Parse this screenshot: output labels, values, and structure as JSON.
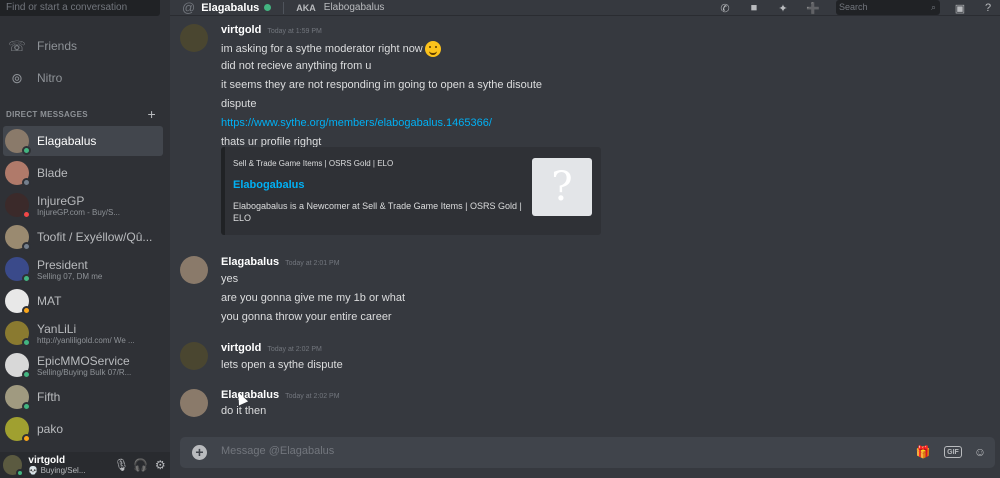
{
  "sidebar": {
    "search_placeholder": "Find or start a conversation",
    "nav": [
      {
        "label": "Friends",
        "icon": "friends-icon"
      },
      {
        "label": "Nitro",
        "icon": "nitro-icon"
      }
    ],
    "dm_header": "DIRECT MESSAGES",
    "dm_add": "+",
    "dms": [
      {
        "name": "Elagabalus",
        "sub": "",
        "status": "online",
        "avatar_color": "#8a7a6a",
        "active": true
      },
      {
        "name": "Blade",
        "sub": "",
        "status": "offline",
        "avatar_color": "#b07a6a",
        "active": false
      },
      {
        "name": "InjureGP",
        "sub": "InjureGP.com - Buy/S...",
        "status": "dnd",
        "avatar_color": "#3b2a2a",
        "active": false
      },
      {
        "name": "Toofit / Exyéllow/Qû...",
        "sub": "",
        "status": "offline",
        "avatar_color": "#9a8a70",
        "active": false
      },
      {
        "name": "President",
        "sub": "Selling 07, DM me",
        "status": "online",
        "avatar_color": "#3a4a8a",
        "active": false
      },
      {
        "name": "MAT",
        "sub": "",
        "status": "idle",
        "avatar_color": "#e8e8e8",
        "active": false
      },
      {
        "name": "YanLiLi",
        "sub": "http://yanliligold.com/ We ...",
        "status": "online",
        "avatar_color": "#8a7a30",
        "active": false
      },
      {
        "name": "EpicMMOService",
        "sub": "Selling/Buying Bulk 07/R...",
        "status": "online",
        "avatar_color": "#d8d8d8",
        "active": false
      },
      {
        "name": "Fifth",
        "sub": "",
        "status": "online",
        "avatar_color": "#a09a80",
        "active": false
      },
      {
        "name": "pako",
        "sub": "",
        "status": "idle",
        "avatar_color": "#a0a030",
        "active": false
      }
    ],
    "user": {
      "name": "virtgold",
      "status": "Buying/Sel..."
    }
  },
  "header": {
    "title": "Elagabalus",
    "aka_label": "AKA",
    "nickname": "Elabogabalus",
    "search_placeholder": "Search"
  },
  "messages": [
    {
      "author": "virtgold",
      "time": "Today at 1:59 PM",
      "avatar_color": "#4a4630",
      "lines": [
        "im asking for a sythe moderator right now",
        "did not recieve anything from u",
        "it seems they are not responding im going to open a sythe disoute",
        "dispute",
        "https://www.sythe.org/members/elabogabalus.1465366/",
        "thats ur profile righgt"
      ]
    },
    {
      "author": "Elagabalus",
      "time": "Today at 2:01 PM",
      "avatar_color": "#8a7a6a",
      "lines": [
        "yes",
        "are you gonna give me my 1b or what",
        "you gonna throw your entire career"
      ]
    },
    {
      "author": "virtgold",
      "time": "Today at 2:02 PM",
      "avatar_color": "#4a4630",
      "lines": [
        "lets open a sythe dispute"
      ]
    },
    {
      "author": "Elagabalus",
      "time": "Today at 2:02 PM",
      "avatar_color": "#8a7a6a",
      "lines": [
        "do it then"
      ]
    }
  ],
  "embed": {
    "provider": "Sell & Trade Game Items | OSRS Gold | ELO",
    "title": "Elabogabalus",
    "description": "Elabogabalus is a Newcomer at Sell & Trade Game Items | OSRS Gold | ELO",
    "thumbnail_glyph": "?"
  },
  "composer": {
    "placeholder": "Message @Elagabalus",
    "gif_label": "GIF"
  },
  "status_colors": {
    "online": "#43b581",
    "idle": "#faa61a",
    "dnd": "#f04747",
    "offline": "#747f8d"
  }
}
